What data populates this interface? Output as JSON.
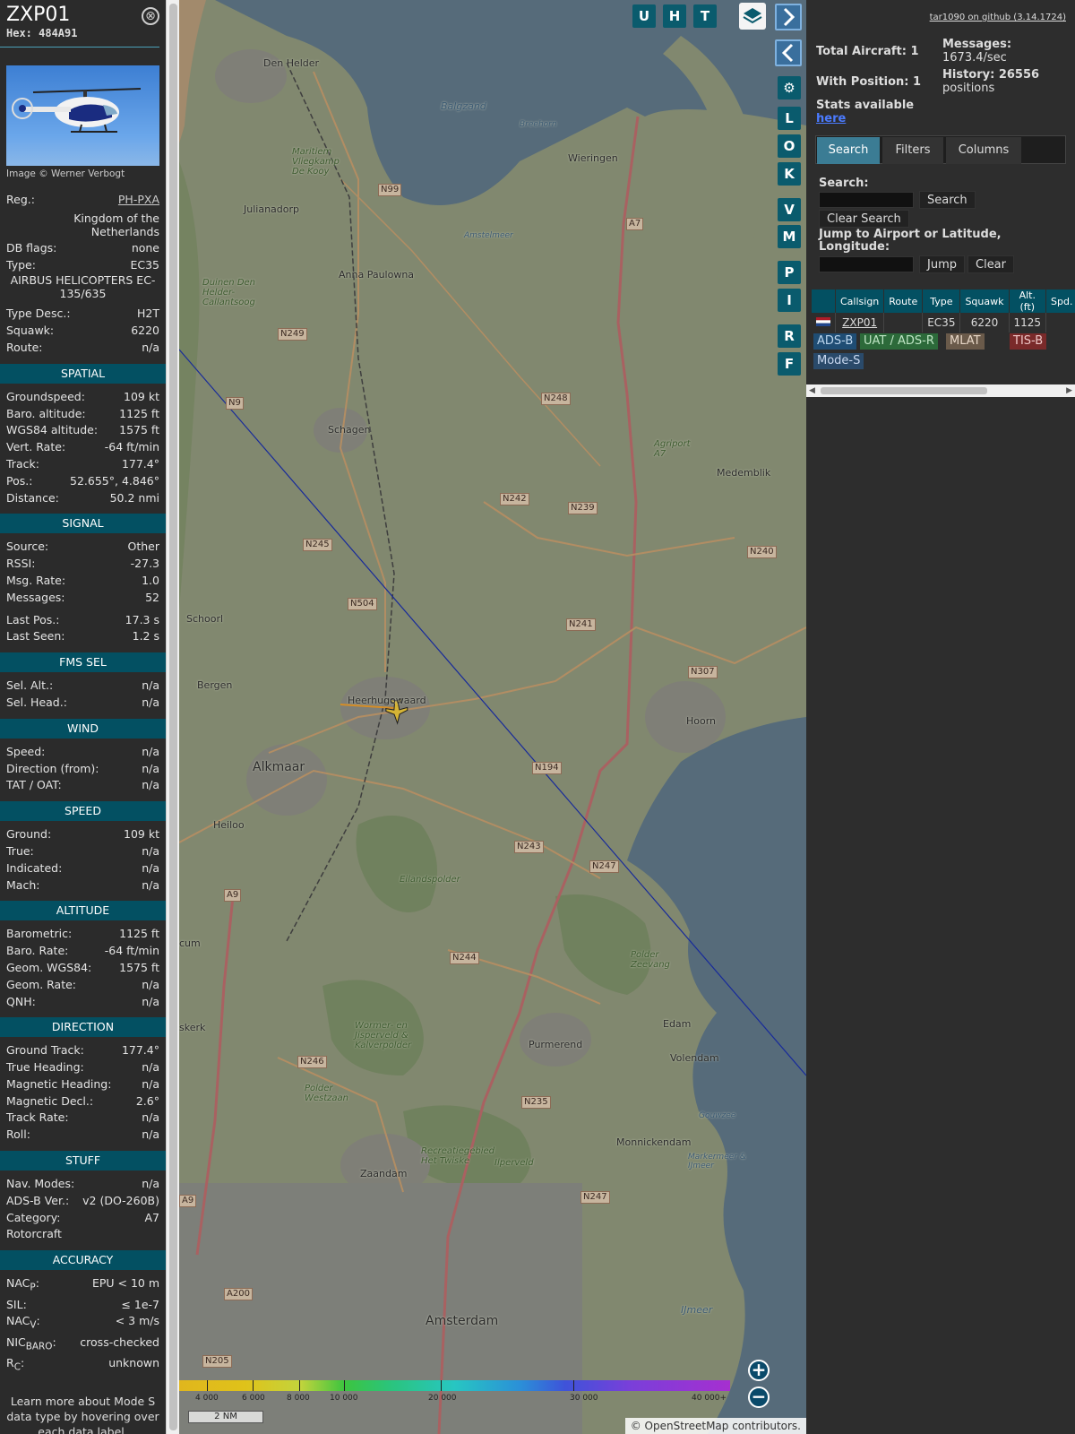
{
  "info": {
    "callsign": "ZXP01",
    "hex": "Hex: 484A91",
    "close_icon": "⊗",
    "credit": "Image © Werner Verbogt",
    "top_rows": [
      {
        "k": "Reg.:",
        "v": "PH-PXA"
      }
    ],
    "country": "Kingdom of the Netherlands",
    "db_flags": {
      "k": "DB flags:",
      "v": "none"
    },
    "type": {
      "k": "Type:",
      "v": "EC35"
    },
    "type_full": "AIRBUS HELICOPTERS EC-135/635",
    "rows2": [
      {
        "k": "Type Desc.:",
        "v": "H2T"
      },
      {
        "k": "Squawk:",
        "v": "6220"
      },
      {
        "k": "Route:",
        "v": "n/a"
      }
    ],
    "spatial_title": "SPATIAL",
    "spatial": [
      {
        "k": "Groundspeed:",
        "v": "109 kt"
      },
      {
        "k": "Baro. altitude:",
        "v": "1125 ft"
      },
      {
        "k": "WGS84 altitude:",
        "v": "1575 ft"
      },
      {
        "k": "Vert. Rate:",
        "v": "-64 ft/min"
      },
      {
        "k": "Track:",
        "v": "177.4°"
      },
      {
        "k": "Pos.:",
        "v": "52.655°, 4.846°"
      },
      {
        "k": "Distance:",
        "v": "50.2 nmi"
      }
    ],
    "signal_title": "SIGNAL",
    "signal": [
      {
        "k": "Source:",
        "v": "Other"
      },
      {
        "k": "RSSI:",
        "v": "-27.3"
      },
      {
        "k": "Msg. Rate:",
        "v": "1.0"
      },
      {
        "k": "Messages:",
        "v": "52"
      }
    ],
    "signal2": [
      {
        "k": "Last Pos.:",
        "v": "17.3 s"
      },
      {
        "k": "Last Seen:",
        "v": "1.2 s"
      }
    ],
    "fms_title": "FMS SEL",
    "fms": [
      {
        "k": "Sel. Alt.:",
        "v": "n/a"
      },
      {
        "k": "Sel. Head.:",
        "v": "n/a"
      }
    ],
    "wind_title": "WIND",
    "wind": [
      {
        "k": "Speed:",
        "v": "n/a"
      },
      {
        "k": "Direction (from):",
        "v": "n/a"
      },
      {
        "k": "TAT / OAT:",
        "v": "n/a"
      }
    ],
    "speed_title": "SPEED",
    "speed": [
      {
        "k": "Ground:",
        "v": "109 kt"
      },
      {
        "k": "True:",
        "v": "n/a"
      },
      {
        "k": "Indicated:",
        "v": "n/a"
      },
      {
        "k": "Mach:",
        "v": "n/a"
      }
    ],
    "altitude_title": "ALTITUDE",
    "altitude": [
      {
        "k": "Barometric:",
        "v": "1125 ft"
      },
      {
        "k": "Baro. Rate:",
        "v": "-64 ft/min"
      },
      {
        "k": "Geom. WGS84:",
        "v": "1575 ft"
      },
      {
        "k": "Geom. Rate:",
        "v": "n/a"
      },
      {
        "k": "QNH:",
        "v": "n/a"
      }
    ],
    "direction_title": "DIRECTION",
    "direction": [
      {
        "k": "Ground Track:",
        "v": "177.4°"
      },
      {
        "k": "True Heading:",
        "v": "n/a"
      },
      {
        "k": "Magnetic Heading:",
        "v": "n/a"
      },
      {
        "k": "Magnetic Decl.:",
        "v": "2.6°"
      },
      {
        "k": "Track Rate:",
        "v": "n/a"
      },
      {
        "k": "Roll:",
        "v": "n/a"
      }
    ],
    "stuff_title": "STUFF",
    "stuff": [
      {
        "k": "Nav. Modes:",
        "v": "n/a"
      },
      {
        "k": "ADS-B Ver.:",
        "v": "v2 (DO-260B)"
      },
      {
        "k": "Category:",
        "v": "A7"
      }
    ],
    "category_desc": "Rotorcraft",
    "accuracy_title": "ACCURACY",
    "accuracy": [
      {
        "k": "NAC",
        "sub": "P",
        "v": "EPU < 10 m"
      },
      {
        "k": "SIL:",
        "sub": "",
        "v": "≤ 1e-7"
      },
      {
        "k": "NAC",
        "sub": "V",
        "v": "< 3 m/s"
      },
      {
        "k": "NIC",
        "sub": "BARO",
        "v": "cross-checked"
      },
      {
        "k": "R",
        "sub": "C",
        "v": "unknown"
      }
    ],
    "learn": "Learn more about Mode S data type by hovering over each data label."
  },
  "map": {
    "buttons_top": [
      "U",
      "H",
      "T"
    ],
    "side_buttons": [
      "L",
      "O",
      "K",
      "V",
      "M",
      "P",
      "I",
      "R",
      "F"
    ],
    "settings_icon": "⚙",
    "places": [
      {
        "name": "Den Helder"
      },
      {
        "name": "Julianadorp"
      },
      {
        "name": "Anna Paulowna"
      },
      {
        "name": "Wieringen"
      },
      {
        "name": "Schagen"
      },
      {
        "name": "Medemblik"
      },
      {
        "name": "Schoorl"
      },
      {
        "name": "Bergen"
      },
      {
        "name": "Heerhugowaard"
      },
      {
        "name": "Hoorn"
      },
      {
        "name": "Alkmaar"
      },
      {
        "name": "Heiloo"
      },
      {
        "name": "Edam"
      },
      {
        "name": "Volendam"
      },
      {
        "name": "Purmerend"
      },
      {
        "name": "Monnickendam"
      },
      {
        "name": "Zaandam"
      },
      {
        "name": "Amsterdam"
      },
      {
        "name": "skerk"
      },
      {
        "name": "cum"
      }
    ],
    "water_labels": [
      "Balgzand",
      "Amstelmeer",
      "Breehorn",
      "IJmeer",
      "Gouwzee",
      "Markermeer & IJmeer",
      "Eilandspolder",
      "Polder Zeevang",
      "Wormer- en Jisperveld & Kalverpolder",
      "Recreatiegebied Het Twiske",
      "Ilperveld",
      "Polder Westzaan",
      "Duinen Den Helder-Callantsoog",
      "Maritiem Vliegkamp De Kooy",
      "Agriport A7"
    ],
    "roads": [
      "N99",
      "A7",
      "N249",
      "N9",
      "N248",
      "N242",
      "N239",
      "N245",
      "N240",
      "N504",
      "N241",
      "N307",
      "N194",
      "N243",
      "N247",
      "A9",
      "N244",
      "N246",
      "N235",
      "A9",
      "A200",
      "N205",
      "N247"
    ],
    "legend_labels": [
      "4 000",
      "6 000",
      "8 000",
      "10 000",
      "20 000",
      "30 000",
      "40 000+"
    ],
    "scale": "2 NM",
    "attribution": "© OpenStreetMap contributors.",
    "zoom_in": "+",
    "zoom_out": "−"
  },
  "right": {
    "github": "tar1090 on github (3.14.1724)",
    "total_aircraft": "Total Aircraft: 1",
    "with_position": "With Position: 1",
    "stats_label": "Stats available",
    "stats_link": "here",
    "messages_label": "Messages:",
    "messages_value": "1673.4/sec",
    "history_label": "History: 26556",
    "history_value": "positions",
    "tabs": [
      "Search",
      "Filters",
      "Columns"
    ],
    "search_label": "Search:",
    "search_button": "Search",
    "clear_search": "Clear Search",
    "jump_label": "Jump to Airport or Latitude, Longitude:",
    "jump_button": "Jump",
    "clear_button": "Clear",
    "table_headers": [
      "",
      "Callsign",
      "Route",
      "Type",
      "Squawk",
      "Alt. (ft)",
      "Spd."
    ],
    "table_row": {
      "callsign": "ZXP01",
      "route": "",
      "type": "EC35",
      "squawk": "6220",
      "alt": "1125",
      "spd": ""
    },
    "sources": [
      {
        "label": "ADS-B",
        "bg": "#1f4d74",
        "fg": "#bcd6ee"
      },
      {
        "label": "UAT / ADS-R",
        "bg": "#2c6a3a",
        "fg": "#bfe5c5"
      },
      {
        "label": "MLAT",
        "bg": "#6a5a4a",
        "fg": "#e8d8c8"
      },
      {
        "label": "TIS-B",
        "bg": "#7a2a2a",
        "fg": "#f0c8c8"
      },
      {
        "label": "Mode-S",
        "bg": "#2a4a6a",
        "fg": "#c8d8f0"
      }
    ]
  }
}
